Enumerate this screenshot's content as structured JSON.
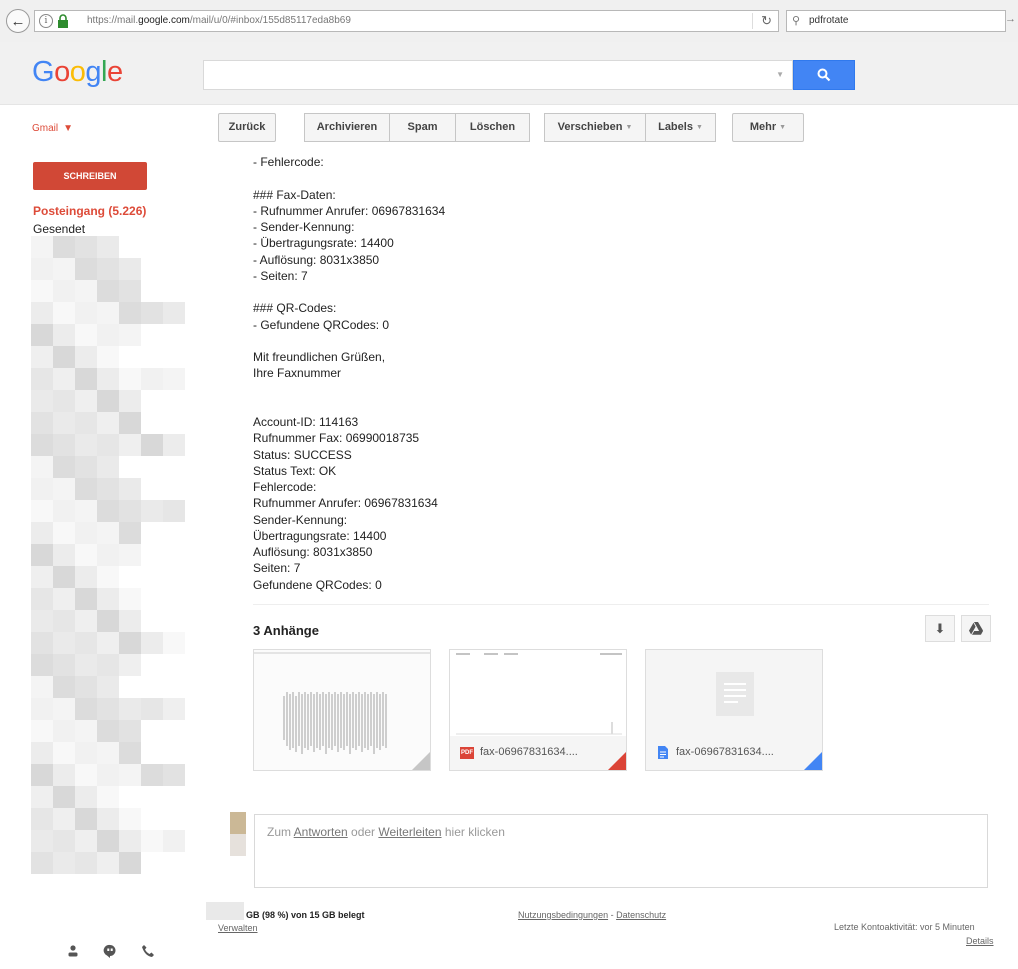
{
  "browser": {
    "url_prefix": "https://mail.",
    "url_domain": "google.com",
    "url_suffix": "/mail/u/0/#inbox/155d85117eda8b69",
    "search_value": "pdfrotate"
  },
  "google": {
    "logo": "Google"
  },
  "gmail": {
    "label": "Gmail",
    "compose": "SCHREIBEN",
    "inbox": "Posteingang (5.226)",
    "sent": "Gesendet"
  },
  "toolbar": {
    "back": "Zurück",
    "archive": "Archivieren",
    "spam": "Spam",
    "delete": "Löschen",
    "move": "Verschieben",
    "labels": "Labels",
    "more": "Mehr"
  },
  "message": {
    "lines": [
      "- Fehlercode:",
      "",
      "### Fax-Daten:",
      "- Rufnummer Anrufer: 06967831634",
      "- Sender-Kennung:",
      "- Übertragungsrate: 14400",
      "- Auflösung: 8031x3850",
      "- Seiten: 7",
      "",
      "### QR-Codes:",
      "- Gefundene QRCodes: 0",
      "",
      "Mit freundlichen Grüßen,",
      "Ihre Faxnummer",
      "",
      "",
      "Account-ID: 114163",
      "Rufnummer Fax: 06990018735",
      "Status: SUCCESS",
      "Status Text: OK",
      "Fehlercode:",
      "Rufnummer Anrufer: 06967831634",
      "Sender-Kennung:",
      "Übertragungsrate: 14400",
      "Auflösung: 8031x3850",
      "Seiten: 7",
      "Gefundene QRCodes: 0"
    ]
  },
  "attachments": {
    "title": "3 Anhänge",
    "files": [
      {
        "name": "",
        "type": "image"
      },
      {
        "name": "fax-06967831634....",
        "type": "pdf",
        "badge": "PDF"
      },
      {
        "name": "fax-06967831634....",
        "type": "doc"
      }
    ]
  },
  "reply": {
    "prefix": "Zum ",
    "reply_link": "Antworten",
    "middle": " oder ",
    "forward_link": "Weiterleiten",
    "suffix": " hier klicken"
  },
  "footer": {
    "quota": "GB (98 %) von 15 GB belegt",
    "manage": "Verwalten",
    "terms": "Nutzungsbedingungen",
    "separator": " - ",
    "privacy": "Datenschutz",
    "activity": "Letzte Kontoaktivität: vor 5 Minuten",
    "details": "Details"
  },
  "colors": {
    "brand_red": "#dd4b39",
    "compose_red": "#d14836",
    "search_blue": "#4285f4"
  }
}
